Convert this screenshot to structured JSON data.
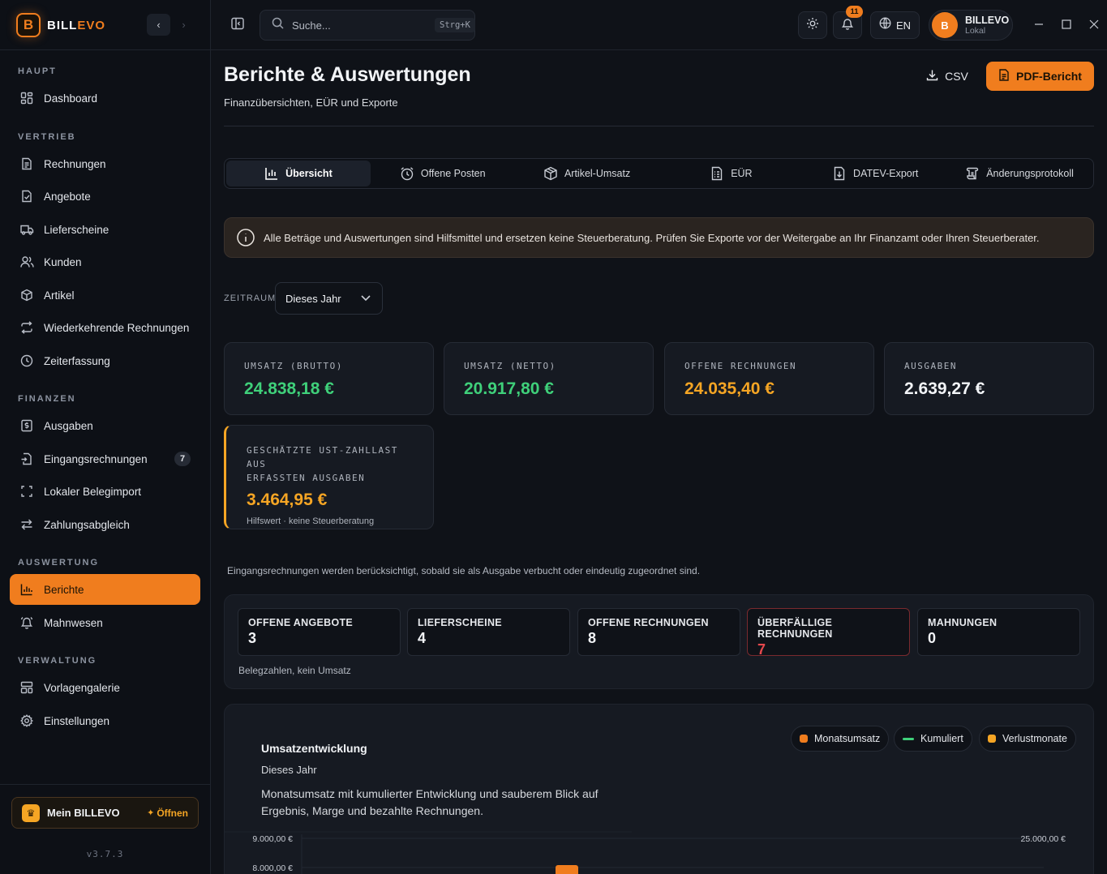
{
  "brand": {
    "prefix": "BILL",
    "suffix": "EVO",
    "logo_letter": "B"
  },
  "sidebar": {
    "sections": [
      {
        "title": "HAUPT"
      },
      {
        "title": "VERTRIEB"
      },
      {
        "title": "FINANZEN"
      },
      {
        "title": "AUSWERTUNG"
      },
      {
        "title": "VERWALTUNG"
      }
    ],
    "items": [
      {
        "label": "Dashboard",
        "icon": "dashboard-icon"
      },
      {
        "label": "Rechnungen",
        "icon": "invoice-icon"
      },
      {
        "label": "Angebote",
        "icon": "offer-icon"
      },
      {
        "label": "Lieferscheine",
        "icon": "truck-icon"
      },
      {
        "label": "Kunden",
        "icon": "users-icon"
      },
      {
        "label": "Artikel",
        "icon": "box-icon"
      },
      {
        "label": "Wiederkehrende Rechnungen",
        "icon": "repeat-icon"
      },
      {
        "label": "Zeiterfassung",
        "icon": "clock-icon"
      },
      {
        "label": "Ausgaben",
        "icon": "expense-icon"
      },
      {
        "label": "Eingangsrechnungen",
        "icon": "incoming-invoice-icon",
        "badge": "7"
      },
      {
        "label": "Lokaler Belegimport",
        "icon": "scan-icon"
      },
      {
        "label": "Zahlungsabgleich",
        "icon": "swap-icon"
      },
      {
        "label": "Berichte",
        "icon": "chart-icon",
        "active": true
      },
      {
        "label": "Mahnwesen",
        "icon": "bell-icon"
      },
      {
        "label": "Vorlagengalerie",
        "icon": "template-icon"
      },
      {
        "label": "Einstellungen",
        "icon": "gear-icon"
      }
    ],
    "mein": {
      "label": "Mein BILLEVO",
      "open": "Öffnen"
    },
    "version": "v3.7.3"
  },
  "topbar": {
    "search_placeholder": "Suche...",
    "shortcut": "Strg+K",
    "notifications": "11",
    "language": "EN",
    "user": {
      "initial": "B",
      "name": "BILLEVO",
      "sub": "Lokal"
    }
  },
  "page": {
    "title": "Berichte & Auswertungen",
    "subtitle": "Finanzübersichten, EÜR und Exporte",
    "csv": "CSV",
    "pdf": "PDF-Bericht"
  },
  "tabs": [
    {
      "label": "Übersicht",
      "icon": "bar-chart-icon",
      "active": true
    },
    {
      "label": "Offene Posten",
      "icon": "alarm-icon"
    },
    {
      "label": "Artikel-Umsatz",
      "icon": "package-icon"
    },
    {
      "label": "EÜR",
      "icon": "file-list-icon"
    },
    {
      "label": "DATEV-Export",
      "icon": "file-download-icon"
    },
    {
      "label": "Änderungsprotokoll",
      "icon": "scroll-icon"
    }
  ],
  "notice": "Alle Beträge und Auswertungen sind Hilfsmittel und ersetzen keine Steuerberatung. Prüfen Sie Exporte vor der Weitergabe an Ihr Finanzamt oder Ihren Steuerberater.",
  "zeitraum": {
    "label": "ZEITRAUM",
    "value": "Dieses Jahr"
  },
  "kpis": [
    {
      "label": "UMSATZ (BRUTTO)",
      "value": "24.838,18 €",
      "color": "#3fd07a"
    },
    {
      "label": "UMSATZ (NETTO)",
      "value": "20.917,80 €",
      "color": "#3fd07a"
    },
    {
      "label": "OFFENE RECHNUNGEN",
      "value": "24.035,40 €",
      "color": "#f5a524"
    },
    {
      "label": "AUSGABEN",
      "value": "2.639,27 €",
      "color": "#f2f4f7"
    }
  ],
  "ust": {
    "label_line1": "GESCHÄTZTE UST-ZAHLLAST AUS",
    "label_line2": "ERFASSTEN AUSGABEN",
    "value": "3.464,95 €",
    "hint": "Hilfswert · keine Steuerberatung",
    "color": "#f5a524"
  },
  "info_line": "Eingangsrechnungen werden berücksichtigt, sobald sie als Ausgabe verbucht oder eindeutig zugeordnet sind.",
  "counts": {
    "items": [
      {
        "label": "OFFENE ANGEBOTE",
        "value": "3"
      },
      {
        "label": "LIEFERSCHEINE",
        "value": "4"
      },
      {
        "label": "OFFENE RECHNUNGEN",
        "value": "8"
      },
      {
        "label": "ÜBERFÄLLIGE RECHNUNGEN",
        "value": "7",
        "warn": true
      },
      {
        "label": "MAHNUNGEN",
        "value": "0"
      }
    ],
    "note": "Belegzahlen, kein Umsatz"
  },
  "chart": {
    "title": "Umsatzentwicklung",
    "period": "Dieses Jahr",
    "description": "Monatsumsatz mit kumulierter Entwicklung und sauberem Blick auf Ergebnis, Marge und bezahlte Rechnungen.",
    "legend": [
      {
        "label": "Monatsumsatz",
        "color": "#f07d1e",
        "kind": "dot"
      },
      {
        "label": "Kumuliert",
        "color": "#3fd07a",
        "kind": "line"
      },
      {
        "label": "Verlustmonate",
        "color": "#f5a524",
        "kind": "dot"
      }
    ]
  },
  "chart_data": {
    "type": "bar",
    "title": "Umsatzentwicklung",
    "y_left_ticks": [
      "9.000,00 €",
      "8.000,00 €"
    ],
    "y_right_ticks": [
      "25.000,00 €"
    ],
    "series": [
      {
        "name": "Monatsumsatz",
        "values": []
      },
      {
        "name": "Kumuliert",
        "values": []
      }
    ]
  }
}
